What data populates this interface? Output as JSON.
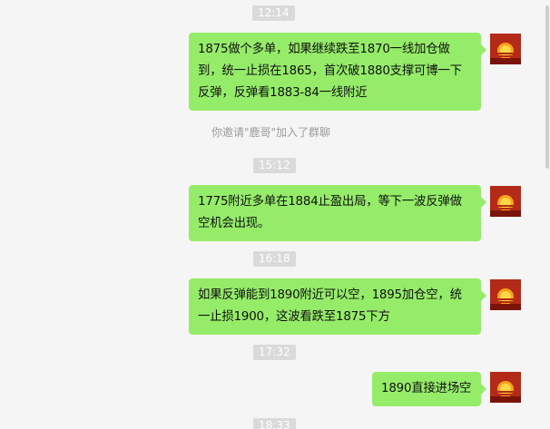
{
  "chat": {
    "items": [
      {
        "type": "time",
        "text": "12:14"
      },
      {
        "type": "message",
        "text": "1875做个多单，如果继续跌至1870一线加仓做到，统一止损在1865，首次破1880支撑可博一下反弹，反弹看1883-84一线附近",
        "avatar": "sunset-avatar-icon"
      },
      {
        "type": "system",
        "text": "你邀请\"鹿哥\"加入了群聊"
      },
      {
        "type": "time",
        "text": "15:12"
      },
      {
        "type": "message",
        "text": "1775附近多单在1884止盈出局，等下一波反弹做空机会出现。",
        "avatar": "sunset-avatar-icon"
      },
      {
        "type": "time",
        "text": "16:18"
      },
      {
        "type": "message",
        "text": "如果反弹能到1890附近可以空，1895加仓空，统一止损1900，这波看跌至1875下方",
        "avatar": "sunset-avatar-icon"
      },
      {
        "type": "time",
        "text": "17:32"
      },
      {
        "type": "message",
        "text": "1890直接进场空",
        "avatar": "sunset-avatar-icon"
      },
      {
        "type": "time",
        "text": "18:33"
      }
    ]
  },
  "colors": {
    "bubble": "#95ec69",
    "background": "#f5f5f5",
    "time_badge": "#dadada"
  }
}
